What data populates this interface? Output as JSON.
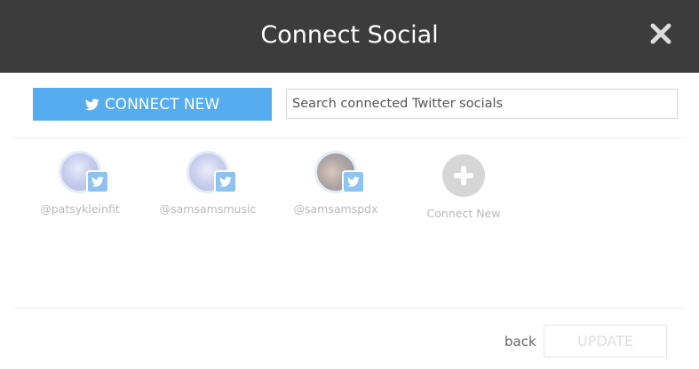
{
  "header": {
    "title": "Connect Social"
  },
  "toolbar": {
    "connect_new_label": "CONNECT NEW",
    "search_placeholder": "Search connected Twitter socials"
  },
  "accounts": [
    {
      "handle": "@patsykleinfit",
      "network": "twitter"
    },
    {
      "handle": "@samsamsmusic",
      "network": "twitter"
    },
    {
      "handle": "@samsamspdx",
      "network": "twitter"
    }
  ],
  "add_tile": {
    "label": "Connect New"
  },
  "footer": {
    "back_label": "back",
    "update_label": "UPDATE"
  },
  "colors": {
    "header_bg": "#3c3c3c",
    "twitter_blue": "#55acee"
  }
}
